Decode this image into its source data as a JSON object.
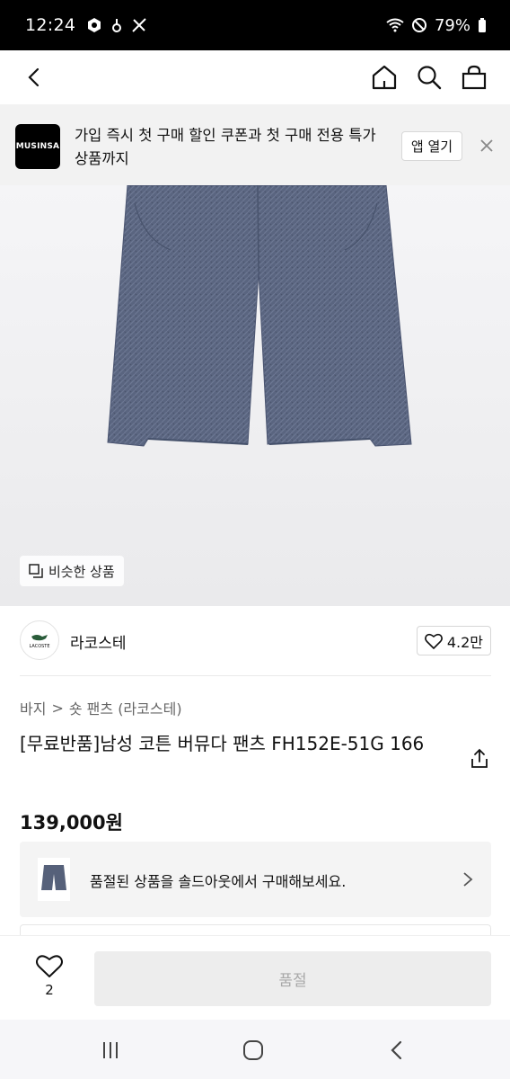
{
  "status_bar": {
    "time": "12:24",
    "battery": "79%"
  },
  "top_nav": {
    "back_icon": "chevron-left-icon",
    "home_icon": "home-icon",
    "search_icon": "search-icon",
    "cart_icon": "shopping-bag-icon"
  },
  "app_banner": {
    "logo_text": "MUSINSA",
    "message": "가입 즉시 첫 구매 할인 쿠폰과 첫 구매 전용 특가 상품까지",
    "open_label": "앱 열기"
  },
  "product_image": {
    "similar_label": "비슷한 상품"
  },
  "brand": {
    "logo_text": "LACOSTE",
    "name": "라코스테",
    "likes": "4.2만"
  },
  "breadcrumb": {
    "category": "바지",
    "separator": ">",
    "subcategory": "숏 팬츠 (라코스테)"
  },
  "product": {
    "title": "[무료반품]남성 코튼 버뮤다 팬츠 FH152E-51G 166",
    "price": "139,000원"
  },
  "soldout_card": {
    "message": "품절된 상품을 솔드아웃에서 구매해보세요."
  },
  "action_bar": {
    "wish_count": "2",
    "button_label": "품절"
  },
  "colors": {
    "pants": "#56617a",
    "button_disabled_bg": "#ededed",
    "button_disabled_text": "#a8a8a8"
  }
}
